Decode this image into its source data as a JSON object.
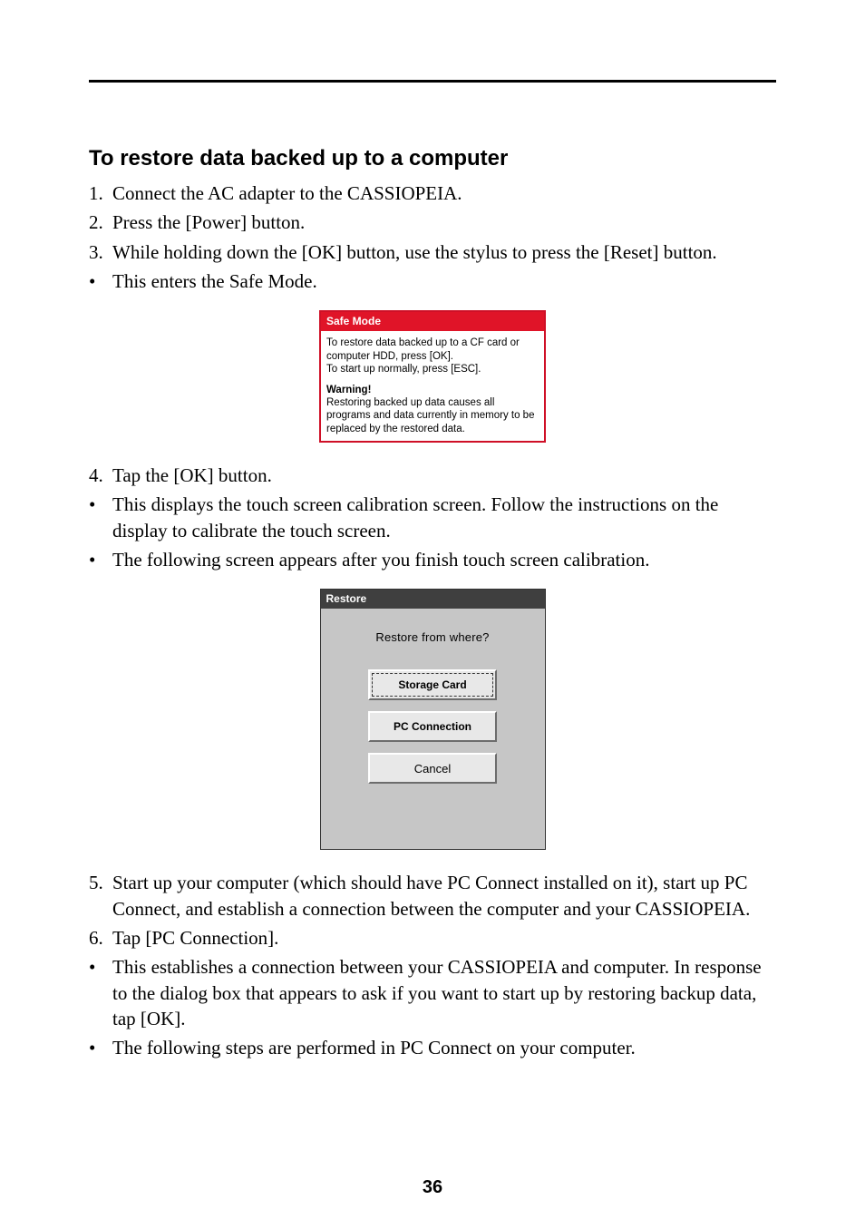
{
  "page_number": "36",
  "section_title": "To restore data backed up to a computer",
  "steps": {
    "s1": {
      "marker": "1.",
      "text": "Connect the AC adapter to the CASSIOPEIA."
    },
    "s2": {
      "marker": "2.",
      "text": "Press the [Power] button."
    },
    "s3": {
      "marker": "3.",
      "text": "While holding down the [OK] button, use the stylus to press the [Reset] button."
    },
    "b1": {
      "marker": "•",
      "text": "This enters the Safe Mode."
    },
    "s4": {
      "marker": "4.",
      "text": "Tap the [OK] button."
    },
    "b2": {
      "marker": "•",
      "text": "This displays the touch screen calibration screen. Follow the instructions on the display to calibrate the touch screen."
    },
    "b3": {
      "marker": "•",
      "text": "The following screen appears after you finish touch screen calibration."
    },
    "s5": {
      "marker": "5.",
      "text": "Start up your computer (which should have PC Connect installed on it), start up PC Connect, and establish a connection between the computer and your CASSIOPEIA."
    },
    "s6": {
      "marker": "6.",
      "text": "Tap [PC Connection]."
    },
    "b4": {
      "marker": "•",
      "text": "This establishes a connection between your CASSIOPEIA and computer. In response to the dialog box that appears to ask if you want to start up by restoring backup data, tap [OK]."
    },
    "b5": {
      "marker": "•",
      "text": "The following steps are performed in PC Connect on your computer."
    }
  },
  "safemode": {
    "title": "Safe Mode",
    "line1": "To restore data backed up to a CF card or computer HDD, press [OK].",
    "line2": "To start up normally, press [ESC].",
    "warning_label": "Warning!",
    "warning_text": "Restoring backed up data causes all programs and data currently in memory to be replaced by the restored data."
  },
  "restore": {
    "title": "Restore",
    "question": "Restore from where?",
    "btn_storage": "Storage Card",
    "btn_pc": "PC Connection",
    "btn_cancel": "Cancel"
  }
}
